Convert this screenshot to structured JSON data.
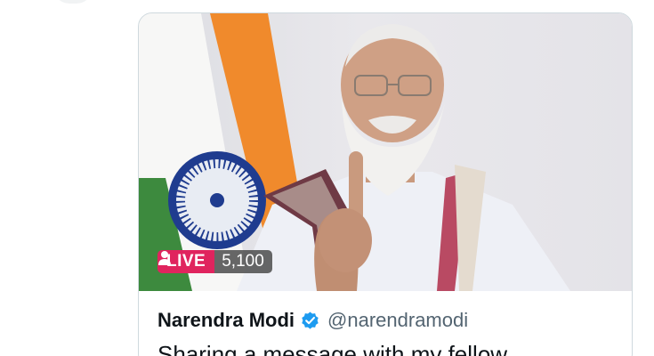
{
  "stream": {
    "live_label": "LIVE",
    "viewer_count": "5,100",
    "viewer_icon": "person-icon"
  },
  "author": {
    "name": "Narendra Modi",
    "handle": "@narendramodi",
    "verified_icon": "verified-badge-icon"
  },
  "tweet": {
    "text": "Sharing a message with my fellow"
  },
  "colors": {
    "live_red": "#e0245e",
    "verified_blue": "#1d9bf0",
    "flag_saffron": "#f08a2c",
    "flag_green": "#3d8a3e",
    "chakra_navy": "#1f3c8f"
  }
}
